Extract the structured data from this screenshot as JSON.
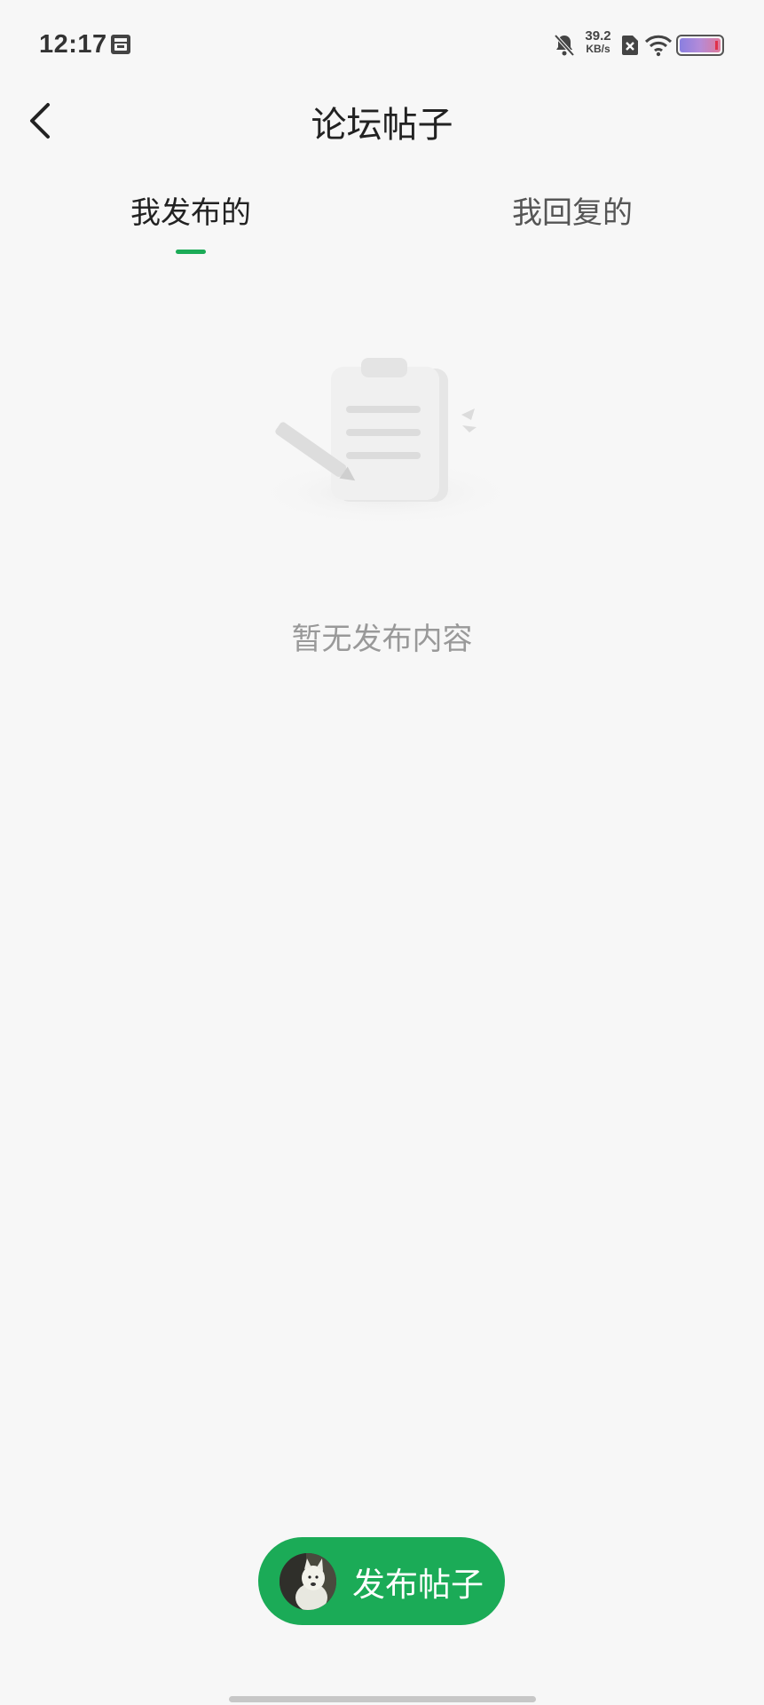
{
  "status_bar": {
    "time": "12:17",
    "net_speed_value": "39.2",
    "net_speed_unit": "KB/s",
    "icons": [
      "calendar-icon",
      "mute-bell-icon",
      "sim-x-icon",
      "wifi-icon",
      "battery-icon"
    ]
  },
  "header": {
    "title": "论坛帖子",
    "back_icon": "chevron-left-icon"
  },
  "tabs": [
    {
      "label": "我发布的",
      "active": true
    },
    {
      "label": "我回复的",
      "active": false
    }
  ],
  "empty_state": {
    "icon": "clipboard-pen-icon",
    "message": "暂无发布内容"
  },
  "fab": {
    "label": "发布帖子",
    "avatar": "dog-avatar-icon"
  },
  "colors": {
    "accent": "#1bab57",
    "background": "#f7f7f7"
  }
}
